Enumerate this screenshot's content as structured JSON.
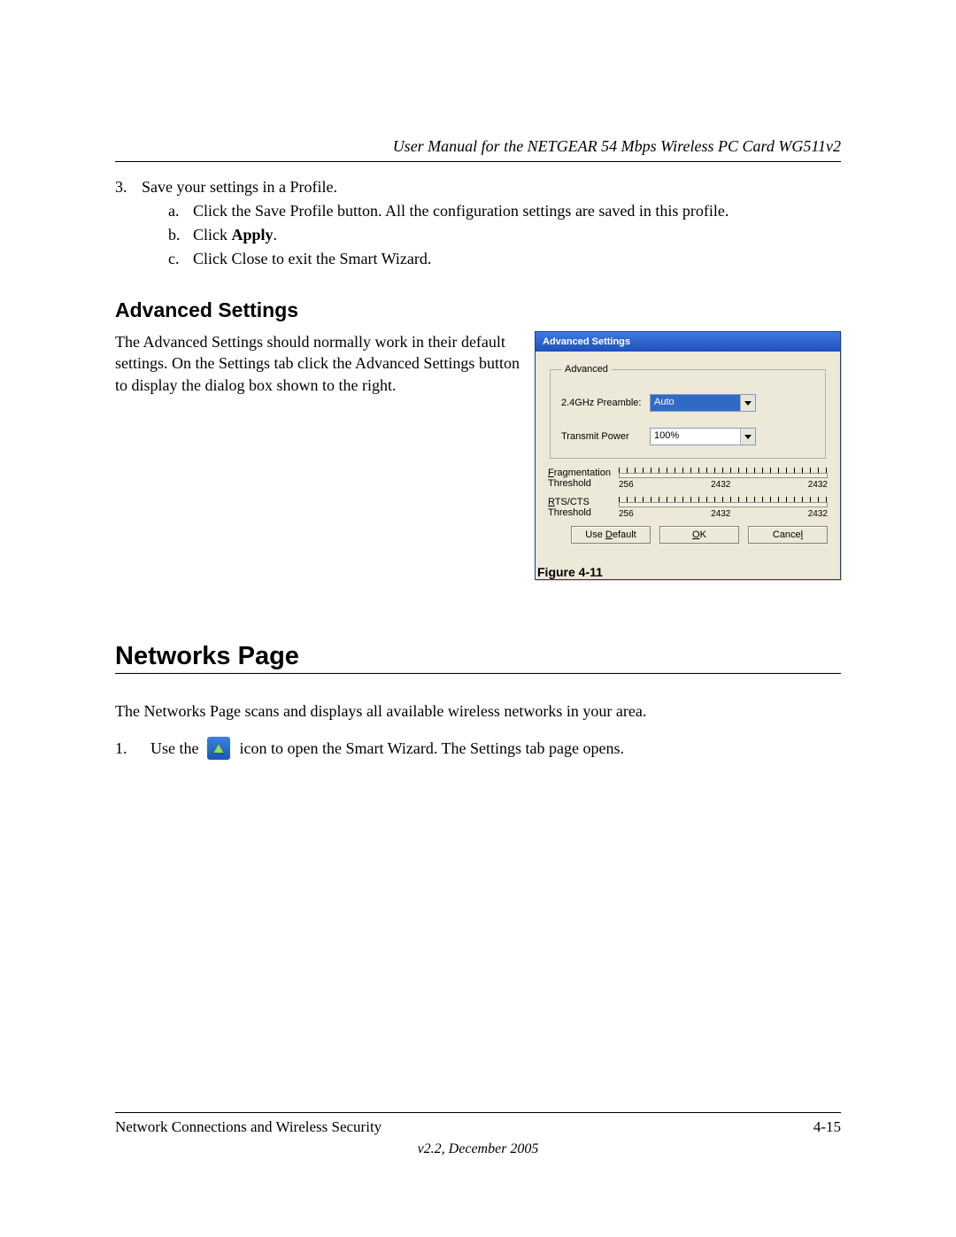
{
  "header": {
    "title": "User Manual for the NETGEAR 54 Mbps Wireless PC Card WG511v2"
  },
  "step3": {
    "num": "3.",
    "text": "Save your settings in a Profile.",
    "a": {
      "al": "a.",
      "text": "Click the Save Profile button. All the configuration settings are saved in this profile."
    },
    "b": {
      "al": "b.",
      "pre": "Click ",
      "bold": "Apply",
      "post": "."
    },
    "c": {
      "al": "c.",
      "text": "Click Close to exit the Smart Wizard."
    }
  },
  "advanced": {
    "heading": "Advanced Settings",
    "para": "The Advanced Settings should normally work in their default settings. On the Settings tab click the Advanced Settings button to display the dialog box shown to the right."
  },
  "dialog": {
    "title": "Advanced Settings",
    "group": "Advanced",
    "preamble": {
      "label": "2.4GHz Preamble:",
      "value": "Auto"
    },
    "power": {
      "label": "Transmit Power",
      "value": "100%"
    },
    "frag": {
      "label_pref": "F",
      "label_rest": "ragmentation",
      "label2": "Threshold",
      "min": "256",
      "mid": "2432",
      "max": "2432"
    },
    "rts": {
      "label_pref": "R",
      "label_rest": "TS/CTS",
      "label2": "Threshold",
      "min": "256",
      "mid": "2432",
      "max": "2432"
    },
    "buttons": {
      "default": {
        "pre": "Use ",
        "u": "D",
        "post": "efault"
      },
      "ok": {
        "pre": "",
        "u": "O",
        "post": "K"
      },
      "cancel": {
        "pre": "Cance",
        "u": "l",
        "post": ""
      }
    },
    "figure": "Figure 4-11"
  },
  "networks": {
    "heading": "Networks Page",
    "para": "The Networks Page scans and displays all available wireless networks in your area.",
    "step": {
      "num": "1.",
      "pre": "Use the",
      "post": "icon to open the Smart Wizard. The Settings tab page opens."
    }
  },
  "footer": {
    "left": "Network Connections and Wireless Security",
    "right": "4-15",
    "version": "v2.2, December 2005"
  }
}
